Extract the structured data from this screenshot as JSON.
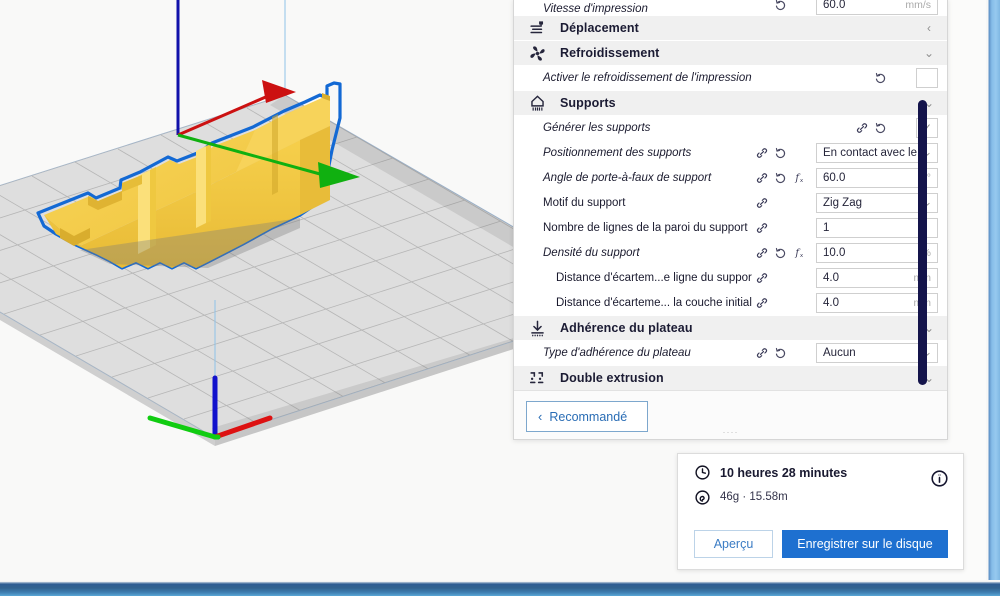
{
  "viewport": {
    "name": "3d-build-plate-viewport",
    "model_color": "#f5cb46",
    "model_outline_color": "#1369d4",
    "plate_color": "#dedede",
    "axis_x_color": "#cc1111",
    "axis_y_color": "#10b010",
    "axis_z_color": "#1111aa",
    "background_color": "#f9f9f8"
  },
  "window": {
    "right_border_color": "#8cc1e8",
    "bottom_bar_color": "#31628f"
  },
  "settings": {
    "scrollbar": {
      "name": "settings-scrollbar",
      "thumb_color": "#14144b"
    },
    "rows": [
      {
        "kind": "setting",
        "label": "Vitesse d'impression",
        "italic": true,
        "indent": false,
        "link": false,
        "reset": true,
        "formula": false,
        "value": "60.0",
        "unit": "mm/s",
        "control": "text",
        "partial_top": true
      },
      {
        "kind": "category",
        "label": "Déplacement",
        "icon": "travel-icon",
        "chevron": "‹"
      },
      {
        "kind": "category",
        "label": "Refroidissement",
        "icon": "fan-icon",
        "chevron": "⌄"
      },
      {
        "kind": "setting",
        "label": "Activer le refroidissement de l'impression",
        "italic": true,
        "indent": false,
        "link": false,
        "reset": true,
        "formula": false,
        "value": "",
        "unit": "",
        "control": "checkbox",
        "checked": false
      },
      {
        "kind": "category",
        "label": "Supports",
        "icon": "support-icon",
        "chevron": "⌄"
      },
      {
        "kind": "setting",
        "label": "Générer les supports",
        "italic": true,
        "indent": false,
        "link": true,
        "reset": true,
        "formula": false,
        "value": "",
        "unit": "",
        "control": "checkbox",
        "checked": true
      },
      {
        "kind": "setting",
        "label": "Positionnement des supports",
        "italic": true,
        "indent": false,
        "link": true,
        "reset": true,
        "formula": false,
        "value": "En contact avec le...",
        "unit": "",
        "control": "dropdown"
      },
      {
        "kind": "setting",
        "label": "Angle de porte-à-faux de support",
        "italic": true,
        "indent": false,
        "link": true,
        "reset": true,
        "formula": true,
        "value": "60.0",
        "unit": "°",
        "control": "text"
      },
      {
        "kind": "setting",
        "label": "Motif du support",
        "italic": false,
        "indent": false,
        "link": true,
        "reset": false,
        "formula": false,
        "value": "Zig Zag",
        "unit": "",
        "control": "dropdown"
      },
      {
        "kind": "setting",
        "label": "Nombre de lignes de la paroi du support",
        "italic": false,
        "indent": false,
        "link": true,
        "reset": false,
        "formula": false,
        "value": "1",
        "unit": "",
        "control": "text"
      },
      {
        "kind": "setting",
        "label": "Densité du support",
        "italic": true,
        "indent": false,
        "link": true,
        "reset": true,
        "formula": true,
        "value": "10.0",
        "unit": "%",
        "control": "text"
      },
      {
        "kind": "setting",
        "label": "Distance d'écartem...e ligne du support",
        "italic": false,
        "indent": true,
        "link": true,
        "reset": false,
        "formula": false,
        "value": "4.0",
        "unit": "mm",
        "control": "text"
      },
      {
        "kind": "setting",
        "label": "Distance d'écarteme... la couche initiale",
        "italic": false,
        "indent": true,
        "link": true,
        "reset": false,
        "formula": false,
        "value": "4.0",
        "unit": "mm",
        "control": "text"
      },
      {
        "kind": "category",
        "label": "Adhérence du plateau",
        "icon": "build-plate-adhesion-icon",
        "chevron": "⌄"
      },
      {
        "kind": "setting",
        "label": "Type d'adhérence du plateau",
        "italic": true,
        "indent": false,
        "link": true,
        "reset": true,
        "formula": false,
        "value": "Aucun",
        "unit": "",
        "control": "dropdown"
      },
      {
        "kind": "category",
        "label": "Double extrusion",
        "icon": "dual-extrusion-icon",
        "chevron": "⌄"
      }
    ],
    "footer": {
      "recommended_button": {
        "label": "Recommandé",
        "chevron": "‹"
      },
      "grip": "····"
    }
  },
  "print_info": {
    "time_icon": "clock-icon",
    "time": "10 heures 28 minutes",
    "material_icon": "spool-icon",
    "material": "46g · 15.58m",
    "info_icon": "info-icon",
    "preview_button": "Aperçu",
    "save_button": "Enregistrer sur le disque",
    "save_button_color": "#1e70d0"
  }
}
